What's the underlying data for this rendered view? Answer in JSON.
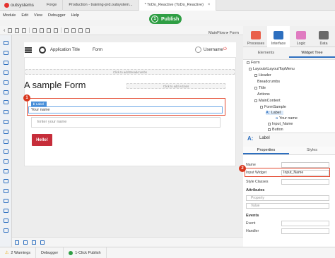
{
  "app": {
    "logo_text": "outsystems",
    "tabs": [
      {
        "label": "Forge"
      },
      {
        "label": "Production - training-prd.outsystem..."
      },
      {
        "label": "* ToDo_Reactive (ToDo_Reactive)"
      }
    ],
    "menu": [
      "Module",
      "Edit",
      "View",
      "Debugger",
      "Help"
    ],
    "publish": {
      "number": "1",
      "label": "Publish"
    }
  },
  "breadcrumb": "MainFlow ▸ Form",
  "canvas": {
    "header": {
      "app_title": "Application Title",
      "form_link": "Form",
      "username": "Username"
    },
    "breadcrumbs_placeholder": "Click to add Breadcrumbs",
    "actions_placeholder": "Click to add Actions",
    "page_title": "A sample Form",
    "label_tag": "⬇ Label",
    "label_text": "Your name",
    "input_placeholder": "Enter your name",
    "button_label": "Hello!",
    "step1": "1"
  },
  "right_panel": {
    "tabs": [
      {
        "label": "Processes",
        "color": "#e9604a"
      },
      {
        "label": "Interface",
        "color": "#2d6fbf"
      },
      {
        "label": "Logic",
        "color": "#e07bc1"
      },
      {
        "label": "Data",
        "color": "#6a6a6a"
      }
    ],
    "subtabs": [
      "Elements",
      "Widget Tree"
    ],
    "tree": [
      {
        "label": "Form"
      },
      {
        "label": "Layouts\\LayoutTopMenu"
      },
      {
        "label": "Header"
      },
      {
        "label": "Breadcrumbs"
      },
      {
        "label": "Title"
      },
      {
        "label": "Actions"
      },
      {
        "label": "MainContent"
      },
      {
        "label": "FormSample"
      },
      {
        "label": "Label"
      },
      {
        "label": "Your name"
      },
      {
        "label": "Input_Name"
      },
      {
        "label": "Button"
      }
    ],
    "props_title": "Label",
    "props_tabs": [
      "Properties",
      "Styles"
    ],
    "name_label": "Name",
    "input_widget_label": "Input Widget",
    "input_widget_value": "Input_Name",
    "style_classes_label": "Style Classes",
    "attributes_head": "Attributes",
    "property_placeholder": "Property",
    "value_placeholder": "Value",
    "events_head": "Events",
    "event_label": "Event",
    "handler_label": "Handler",
    "step2": "2"
  },
  "statusbar": {
    "warnings": "2 Warnings",
    "debugger": "Debugger",
    "publish": "1-Click Publish"
  }
}
